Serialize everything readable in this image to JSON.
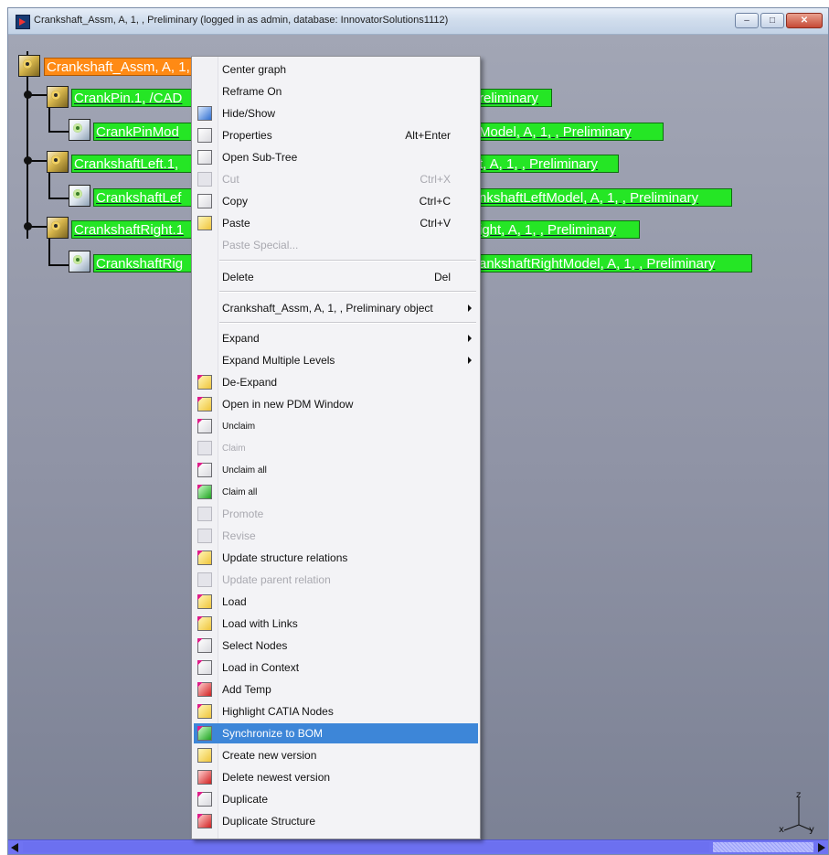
{
  "window": {
    "title": "Crankshaft_Assm, A, 1, , Preliminary (logged in as admin, database: InnovatorSolutions1112)",
    "buttons": [
      "minimize",
      "maximize",
      "close"
    ]
  },
  "tree": {
    "root": "Crankshaft_Assm, A, 1, , Preliminary",
    "nodes": [
      {
        "label_left": "CrankPin.1, /CAD",
        "label_right": "reliminary"
      },
      {
        "label_left": "CrankPinMod",
        "label_right": "Model, A, 1, , Preliminary"
      },
      {
        "label_left": "CrankshaftLeft.1,",
        "label_right": "t, A, 1, , Preliminary"
      },
      {
        "label_left": "CrankshaftLef",
        "label_right": "nkshaftLeftModel, A, 1, , Preliminary"
      },
      {
        "label_left": "CrankshaftRight.1",
        "label_right": "ight, A, 1, , Preliminary"
      },
      {
        "label_left": "CrankshaftRig",
        "label_right": "ankshaftRightModel, A, 1, , Preliminary"
      }
    ]
  },
  "axis": {
    "z": "z",
    "x": "x",
    "y": "y"
  },
  "menu": {
    "items": [
      {
        "label": "Center graph",
        "icon": "none"
      },
      {
        "label": "Reframe On",
        "icon": "none"
      },
      {
        "label": "Hide/Show",
        "icon": "hide-show-icon"
      },
      {
        "label": "Properties",
        "accel": "Alt+Enter",
        "icon": "properties-icon"
      },
      {
        "label": "Open Sub-Tree",
        "icon": "open-subtree-icon"
      },
      {
        "label": "Cut",
        "accel": "Ctrl+X",
        "disabled": true,
        "icon": "scissors-icon"
      },
      {
        "label": "Copy",
        "accel": "Ctrl+C",
        "icon": "copy-icon"
      },
      {
        "label": "Paste",
        "accel": "Ctrl+V",
        "icon": "paste-icon"
      },
      {
        "label": "Paste Special...",
        "disabled": true,
        "icon": "none"
      },
      {
        "label": "Delete",
        "accel": "Del",
        "icon": "none"
      },
      {
        "label": "Crankshaft_Assm, A, 1, , Preliminary object",
        "submenu": true,
        "icon": "none"
      },
      {
        "label": "Expand",
        "submenu": true,
        "icon": "none"
      },
      {
        "label": "Expand Multiple Levels",
        "submenu": true,
        "icon": "none"
      },
      {
        "label": "De-Expand",
        "icon": "de-expand-icon"
      },
      {
        "label": "Open in new PDM Window",
        "icon": "pdm-window-icon"
      },
      {
        "label": "Unclaim",
        "icon": "unclaim-icon"
      },
      {
        "label": "Claim",
        "disabled": true,
        "icon": "claim-icon"
      },
      {
        "label": "Unclaim all",
        "icon": "unclaim-all-icon"
      },
      {
        "label": "Claim all",
        "icon": "claim-all-icon"
      },
      {
        "label": "Promote",
        "disabled": true,
        "icon": "promote-icon"
      },
      {
        "label": "Revise",
        "disabled": true,
        "icon": "revise-icon"
      },
      {
        "label": "Update structure relations",
        "icon": "update-structure-icon"
      },
      {
        "label": "Update parent relation",
        "disabled": true,
        "icon": "update-parent-icon"
      },
      {
        "label": "Load",
        "icon": "load-icon"
      },
      {
        "label": "Load with Links",
        "icon": "load-links-icon"
      },
      {
        "label": "Select Nodes",
        "icon": "select-nodes-icon"
      },
      {
        "label": "Load in Context",
        "icon": "load-context-icon"
      },
      {
        "label": "Add Temp",
        "icon": "add-temp-icon"
      },
      {
        "label": "Highlight CATIA Nodes",
        "icon": "highlight-icon"
      },
      {
        "label": "Synchronize to BOM",
        "icon": "sync-bom-icon",
        "highlighted": true
      },
      {
        "label": "Create new version",
        "icon": "new-version-icon"
      },
      {
        "label": "Delete newest version",
        "icon": "delete-version-icon"
      },
      {
        "label": "Duplicate",
        "icon": "duplicate-icon"
      },
      {
        "label": "Duplicate Structure",
        "icon": "duplicate-structure-icon"
      }
    ]
  }
}
